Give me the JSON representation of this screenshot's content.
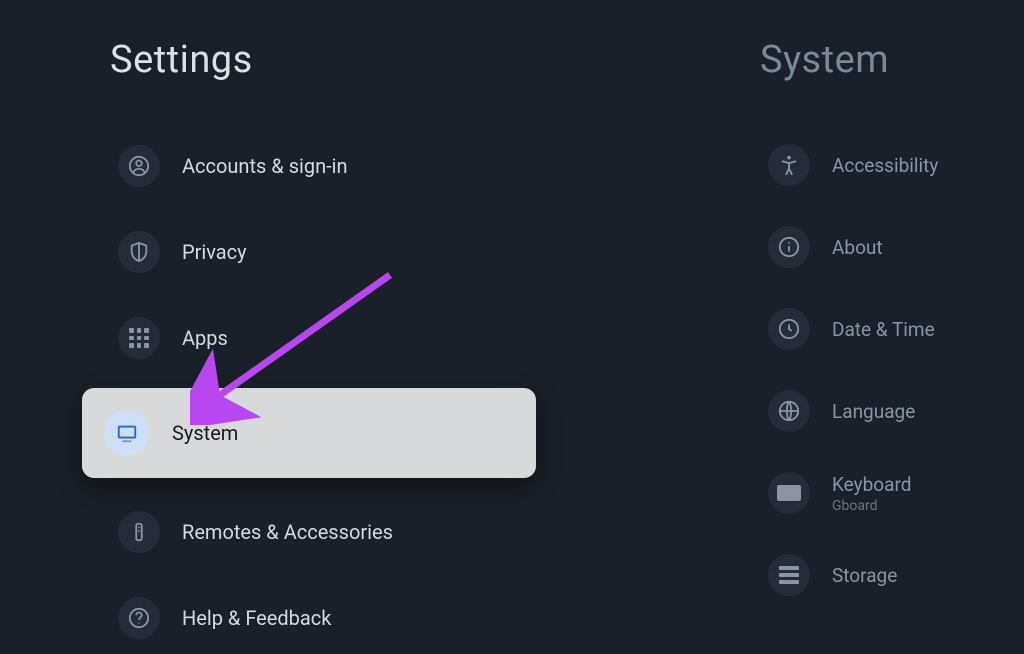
{
  "left": {
    "title": "Settings",
    "items": [
      {
        "label": "Accounts & sign-in",
        "icon": "account",
        "selected": false
      },
      {
        "label": "Privacy",
        "icon": "privacy",
        "selected": false
      },
      {
        "label": "Apps",
        "icon": "apps",
        "selected": false
      },
      {
        "label": "System",
        "icon": "system",
        "selected": true
      },
      {
        "label": "Remotes & Accessories",
        "icon": "remote",
        "selected": false
      },
      {
        "label": "Help & Feedback",
        "icon": "help",
        "selected": false
      }
    ]
  },
  "right": {
    "title": "System",
    "items": [
      {
        "label": "Accessibility",
        "sublabel": "",
        "icon": "accessibility"
      },
      {
        "label": "About",
        "sublabel": "",
        "icon": "info"
      },
      {
        "label": "Date & Time",
        "sublabel": "",
        "icon": "clock"
      },
      {
        "label": "Language",
        "sublabel": "",
        "icon": "globe"
      },
      {
        "label": "Keyboard",
        "sublabel": "Gboard",
        "icon": "keyboard"
      },
      {
        "label": "Storage",
        "sublabel": "",
        "icon": "storage"
      }
    ]
  }
}
